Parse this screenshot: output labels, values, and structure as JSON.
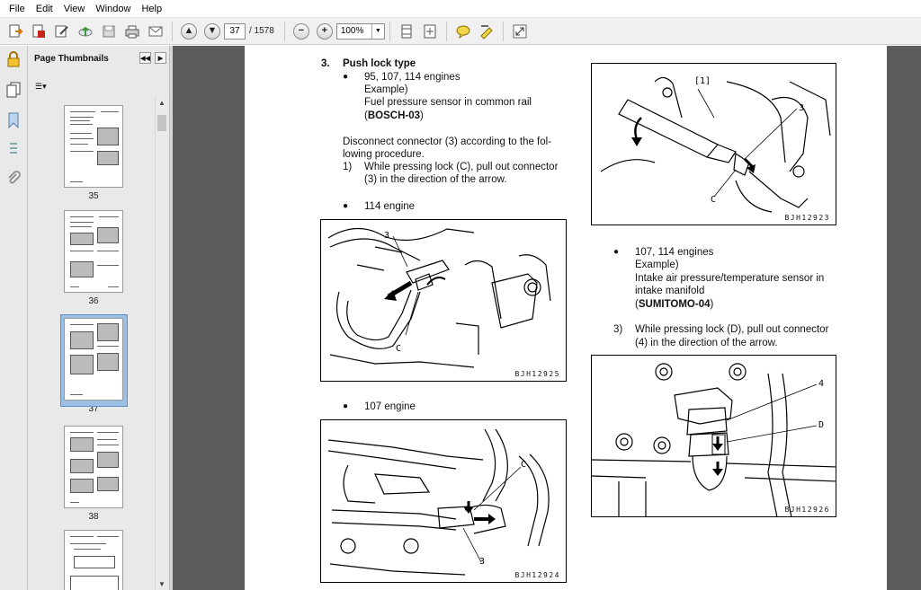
{
  "menu": [
    "File",
    "Edit",
    "View",
    "Window",
    "Help"
  ],
  "toolbar": {
    "current_page": "37",
    "total_pages": "/ 1578",
    "zoom": "100%",
    "zoom_arrow": "▼"
  },
  "panel": {
    "title": "Page Thumbnails",
    "collapse_glyph": "◀◀",
    "expand_glyph": "▶",
    "options_glyph": "☰▾",
    "thumbnails": [
      {
        "label": "35"
      },
      {
        "label": "36"
      },
      {
        "label": "37",
        "selected": true
      },
      {
        "label": "38"
      },
      {
        "label": ""
      }
    ]
  },
  "document": {
    "section_num": "3.",
    "section_title": "Push lock type",
    "bullet": "●",
    "bullet1": "95, 107, 114 engines",
    "example": "Example)",
    "sensor1": "Fuel pressure sensor in common rail",
    "paren_open": "(",
    "paren_close": ")",
    "code1": "BOSCH-03",
    "disconnect1": "Disconnect connector (3) according to the fol-",
    "disconnect2": "lowing procedure.",
    "step1_num": "1)",
    "step1_a": "While pressing lock (C), pull out connector",
    "step1_b": "(3) in the direction of the arrow.",
    "bullet_114": "114 engine",
    "bullet_107": "107 engine",
    "bullet2": "107, 114 engines",
    "sensor2_a": "Intake air pressure/temperature sensor in",
    "sensor2_b": "intake manifold",
    "code2": "SUMITOMO-04",
    "step3_num": "3)",
    "step3_a": "While pressing lock (D), pull out connector",
    "step3_b": "(4) in the direction of the arrow."
  },
  "figures": {
    "fig1": {
      "code": "BJH12925",
      "labels": [
        "3",
        "C"
      ]
    },
    "fig2": {
      "code": "BJH12924",
      "labels": [
        "C",
        "3"
      ]
    },
    "fig3": {
      "code": "BJH12923",
      "labels": [
        "[1]",
        "3",
        "C"
      ]
    },
    "fig4": {
      "code": "BJH12926",
      "labels": [
        "4",
        "D"
      ]
    }
  },
  "icons": [
    "open-icon",
    "create-icon",
    "edit-icon",
    "upload-icon",
    "save-icon",
    "print-icon",
    "email-icon",
    "prev-page-icon",
    "next-page-icon",
    "zoom-out-icon",
    "zoom-in-icon",
    "fit-width-icon",
    "fit-page-icon",
    "comment-icon",
    "highlight-icon",
    "expand-icon",
    "lock-icon",
    "pages-icon",
    "bookmark-icon",
    "attachments-icon",
    "paperclip-icon"
  ]
}
